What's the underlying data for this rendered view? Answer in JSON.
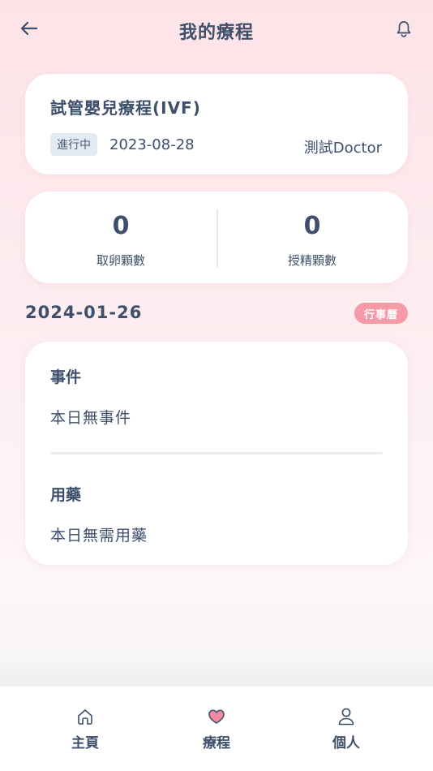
{
  "header": {
    "title": "我的療程",
    "back_icon": "arrow-left-icon",
    "notification_icon": "bell-icon"
  },
  "treatment": {
    "name": "試管嬰兒療程(IVF)",
    "status": "進行中",
    "start_date": "2023-08-28",
    "doctor": "測試Doctor"
  },
  "stats": {
    "eggs_retrieved": {
      "value": "0",
      "label": "取卵顆數"
    },
    "eggs_fertilized": {
      "value": "0",
      "label": "授精顆數"
    }
  },
  "schedule": {
    "date": "2024-01-26",
    "calendar_label": "行事曆"
  },
  "events": {
    "heading": "事件",
    "empty_text": "本日無事件"
  },
  "medication": {
    "heading": "用藥",
    "empty_text": "本日無需用藥"
  },
  "tabbar": {
    "items": [
      {
        "label": "主頁",
        "icon": "home-icon"
      },
      {
        "label": "療程",
        "icon": "heart-icon"
      },
      {
        "label": "個人",
        "icon": "user-icon"
      }
    ],
    "active_index": 1
  },
  "colors": {
    "primary_text": "#3d4f6b",
    "accent_pink": "#f69aa7",
    "heart_pink": "#f08aa0",
    "status_badge_bg": "#e4eaf1"
  }
}
